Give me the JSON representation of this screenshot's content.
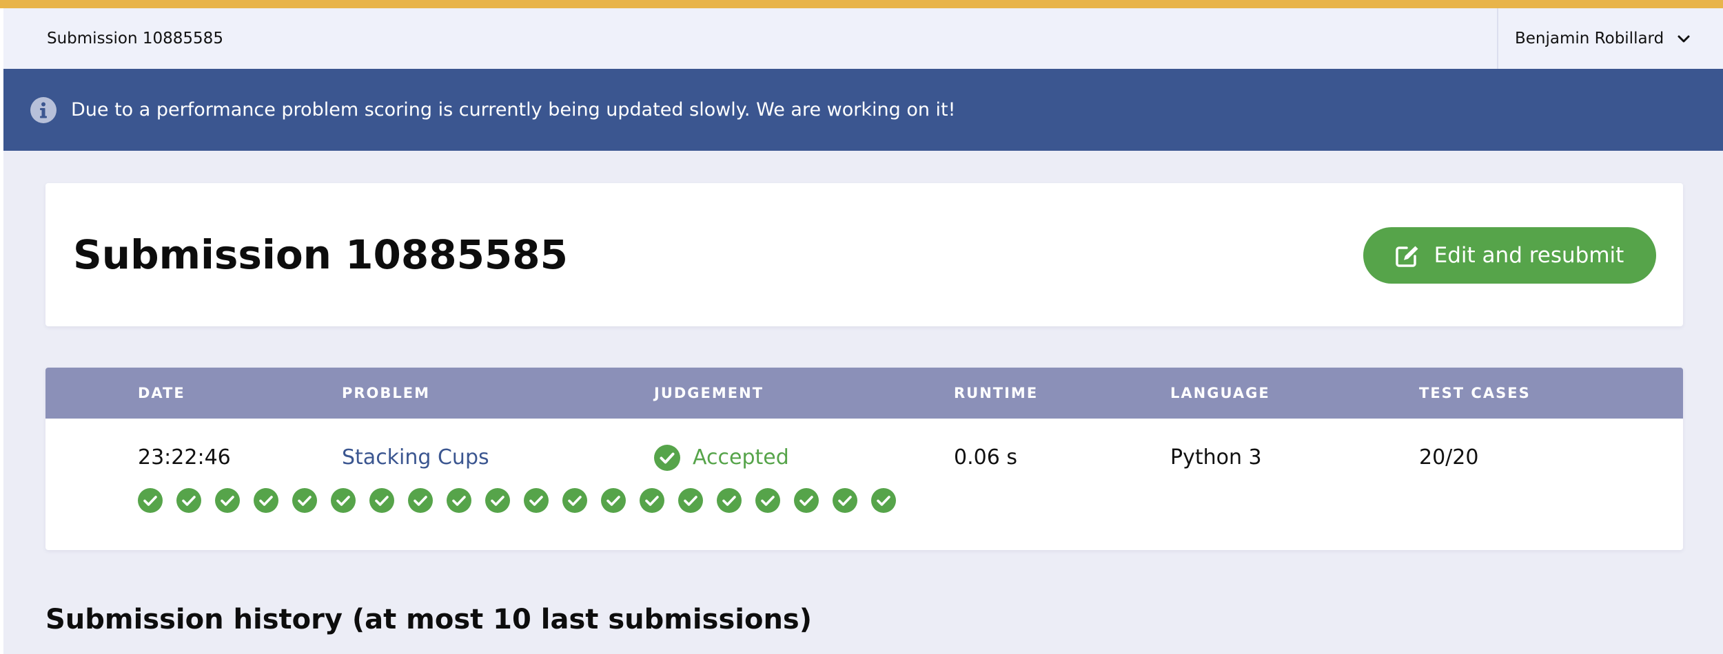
{
  "colors": {
    "accent_bar": "#e8b44a",
    "banner_bg": "#3b5690",
    "success": "#56a44a",
    "table_header_bg": "#8b90b8",
    "link": "#3b5690"
  },
  "header": {
    "title": "Submission 10885585",
    "user": {
      "name": "Benjamin Robillard",
      "icon": "chevron-down-icon"
    }
  },
  "banner": {
    "icon": "info-icon",
    "message": "Due to a performance problem scoring is currently being updated slowly. We are working on it!"
  },
  "submission": {
    "title": "Submission 10885585",
    "resubmit_button": {
      "label": "Edit and resubmit",
      "icon": "edit-icon"
    }
  },
  "table": {
    "columns": [
      "DATE",
      "PROBLEM",
      "JUDGEMENT",
      "RUNTIME",
      "LANGUAGE",
      "TEST CASES"
    ],
    "row": {
      "date": "23:22:46",
      "problem": "Stacking Cups",
      "judgement": "Accepted",
      "judgement_icon": "check-circle-icon",
      "runtime": "0.06 s",
      "language": "Python 3",
      "test_cases": "20/20"
    },
    "test_case_results": [
      "passed",
      "passed",
      "passed",
      "passed",
      "passed",
      "passed",
      "passed",
      "passed",
      "passed",
      "passed",
      "passed",
      "passed",
      "passed",
      "passed",
      "passed",
      "passed",
      "passed",
      "passed",
      "passed",
      "passed"
    ]
  },
  "history": {
    "title": "Submission history (at most 10 last submissions)"
  }
}
